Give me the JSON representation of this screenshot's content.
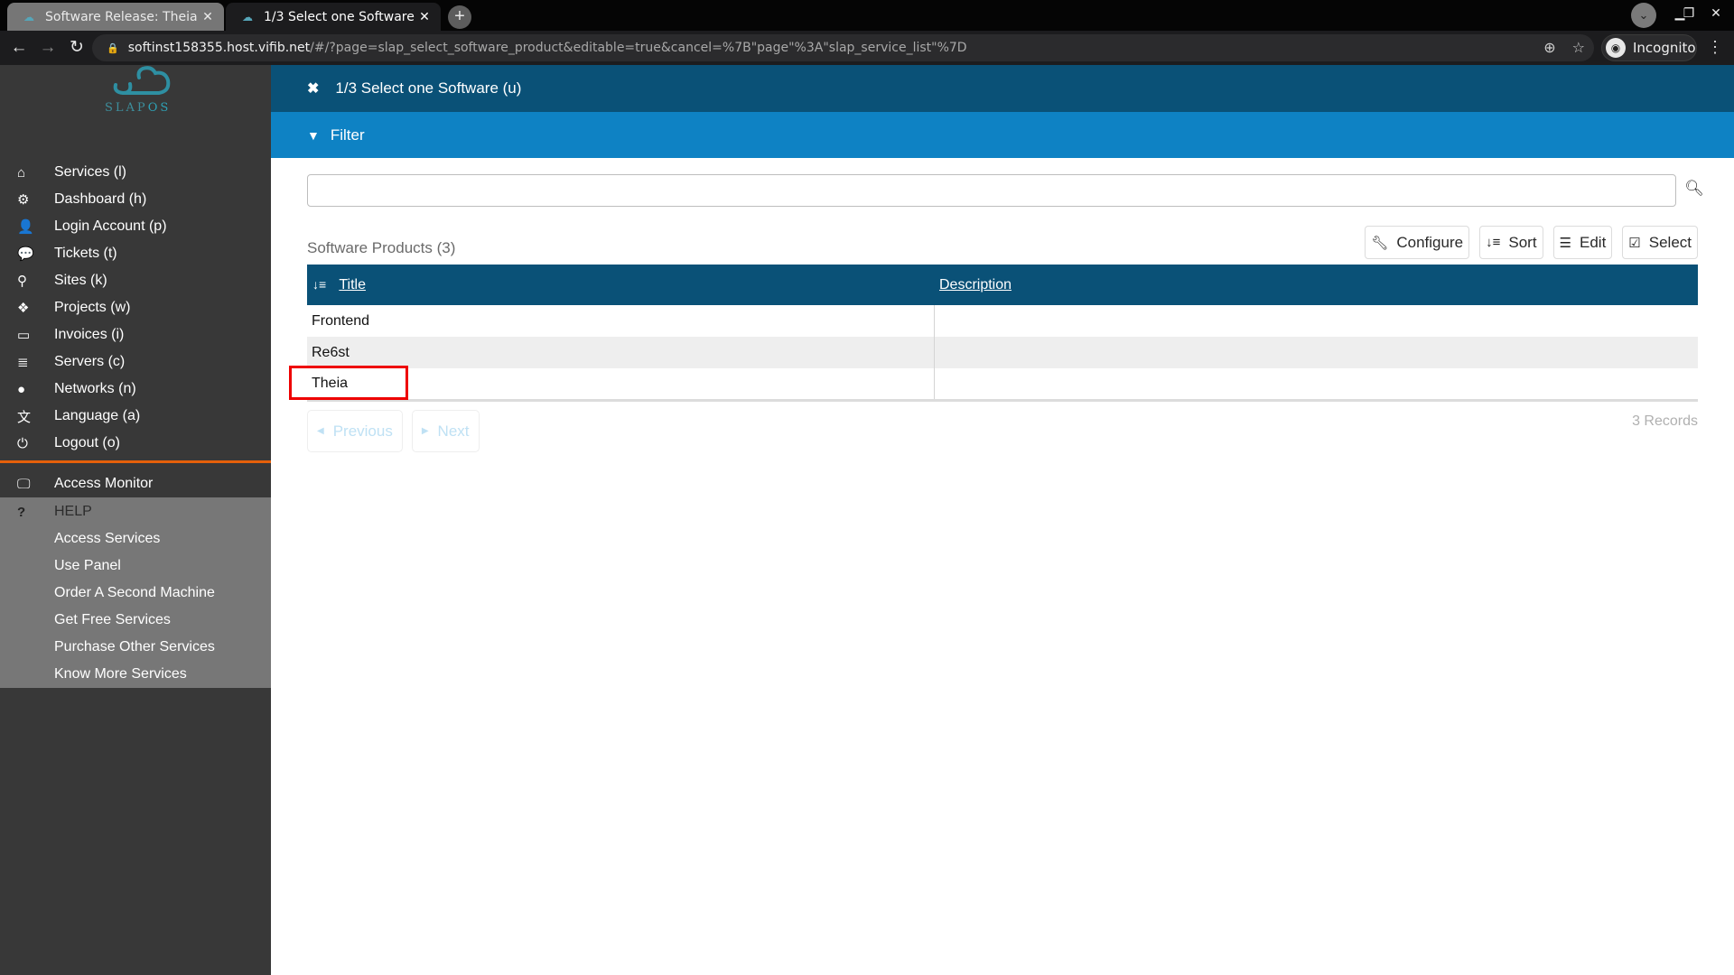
{
  "browser": {
    "tabs": [
      {
        "title": "Software Release: Theia",
        "active": false
      },
      {
        "title": "1/3 Select one Software",
        "active": true
      }
    ],
    "url_host": "softinst158355.host.vifib.net",
    "url_path": "/#/?page=slap_select_software_product&editable=true&cancel=%7B\"page\"%3A\"slap_service_list\"%7D",
    "profile_label": "Incognito"
  },
  "sidebar": {
    "logo_text_a": "SLAP",
    "logo_text_b": "OS",
    "items": [
      {
        "label": "Services (l)",
        "icon": "home-icon"
      },
      {
        "label": "Dashboard (h)",
        "icon": "cogs-icon"
      },
      {
        "label": "Login Account (p)",
        "icon": "user-icon"
      },
      {
        "label": "Tickets (t)",
        "icon": "comments-icon"
      },
      {
        "label": "Sites (k)",
        "icon": "map-marker-icon"
      },
      {
        "label": "Projects (w)",
        "icon": "cubes-icon"
      },
      {
        "label": "Invoices (i)",
        "icon": "credit-card-icon"
      },
      {
        "label": "Servers (c)",
        "icon": "database-icon"
      },
      {
        "label": "Networks (n)",
        "icon": "globe-icon"
      },
      {
        "label": "Language (a)",
        "icon": "language-icon"
      },
      {
        "label": "Logout (o)",
        "icon": "power-icon"
      }
    ],
    "access_monitor": "Access Monitor",
    "help": {
      "heading": "HELP",
      "items": [
        "Access Services",
        "Use Panel",
        "Order A Second Machine",
        "Get Free Services",
        "Purchase Other Services",
        "Know More Services"
      ]
    }
  },
  "main": {
    "header_title": "1/3 Select one Software (u)",
    "filter_label": "Filter",
    "search": {
      "value": "",
      "placeholder": ""
    },
    "list_caption": "Software Products (3)",
    "actions": [
      "Configure",
      "Sort",
      "Edit",
      "Select"
    ],
    "table": {
      "columns": [
        "Title",
        "Description"
      ],
      "rows": [
        {
          "title": "Frontend",
          "description": ""
        },
        {
          "title": "Re6st",
          "description": ""
        },
        {
          "title": "Theia",
          "description": ""
        }
      ]
    },
    "pager": {
      "previous": "Previous",
      "next": "Next"
    },
    "records": "3 Records"
  },
  "colors": {
    "header": "#0a5177",
    "filter": "#0e82c4",
    "sidebar": "#383838",
    "help_section": "#777777",
    "divider": "#e5600a",
    "highlight": "#ee0000"
  }
}
